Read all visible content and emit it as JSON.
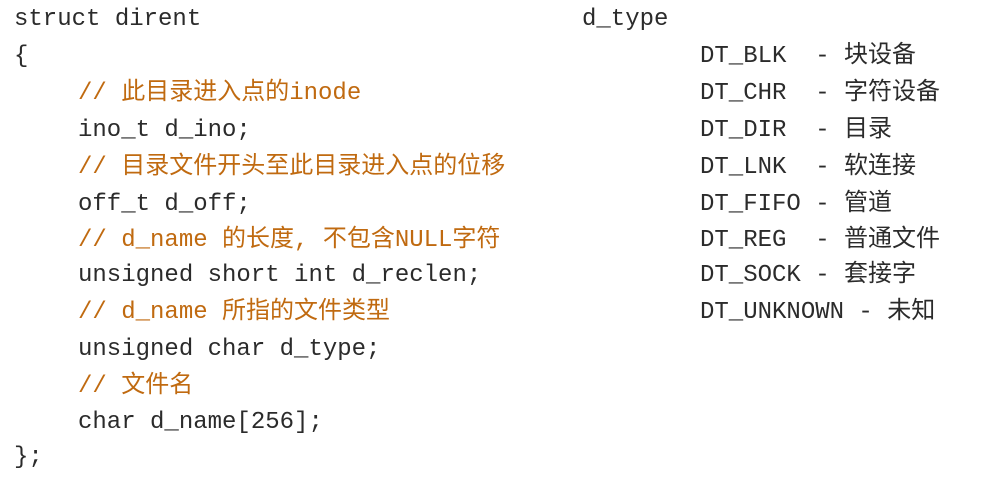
{
  "code": {
    "lines": [
      {
        "text": "struct dirent",
        "type": "code"
      },
      {
        "text": "{",
        "type": "code"
      },
      {
        "text": "// 此目录进入点的inode",
        "type": "comment"
      },
      {
        "text": "ino_t d_ino;",
        "type": "code"
      },
      {
        "text": "// 目录文件开头至此目录进入点的位移",
        "type": "comment"
      },
      {
        "text": "off_t d_off;",
        "type": "code"
      },
      {
        "text": "// d_name 的长度, 不包含NULL字符",
        "type": "comment"
      },
      {
        "text": "unsigned short int d_reclen;",
        "type": "code"
      },
      {
        "text": "// d_name 所指的文件类型",
        "type": "comment"
      },
      {
        "text": "unsigned char d_type;",
        "type": "code"
      },
      {
        "text": "// 文件名",
        "type": "comment"
      },
      {
        "text": "char d_name[256];",
        "type": "code"
      },
      {
        "text": "};",
        "type": "code"
      }
    ]
  },
  "d_type": {
    "title": "d_type",
    "items": [
      {
        "text": "DT_BLK  - 块设备"
      },
      {
        "text": "DT_CHR  - 字符设备"
      },
      {
        "text": "DT_DIR  - 目录"
      },
      {
        "text": "DT_LNK  - 软连接"
      },
      {
        "text": "DT_FIFO - 管道"
      },
      {
        "text": "DT_REG  - 普通文件"
      },
      {
        "text": "DT_SOCK - 套接字"
      },
      {
        "text": "DT_UNKNOWN - 未知"
      }
    ]
  },
  "colors": {
    "code": "#2b2b2b",
    "comment": "#c06a10",
    "background": "#ffffff"
  }
}
